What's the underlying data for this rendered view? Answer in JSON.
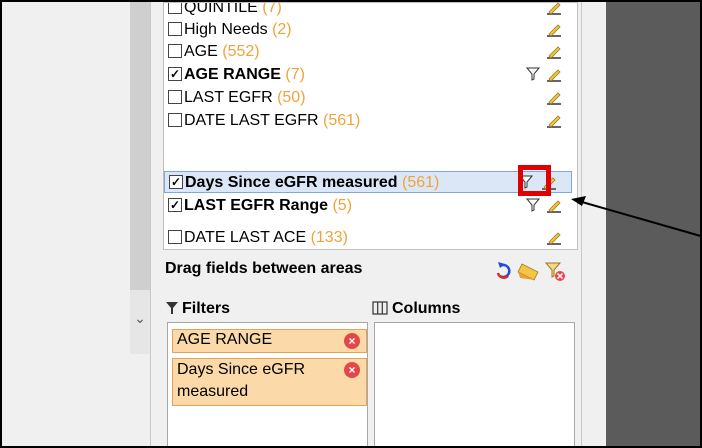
{
  "field_list": {
    "items": [
      {
        "label": "QUINTILE",
        "count": "(7)",
        "checked": false,
        "bold": false
      },
      {
        "label": "High Needs",
        "count": "(2)",
        "checked": false,
        "bold": false
      },
      {
        "label": "AGE",
        "count": "(552)",
        "checked": false,
        "bold": false
      },
      {
        "label": "AGE RANGE",
        "count": "(7)",
        "checked": true,
        "bold": true
      },
      {
        "label": "LAST EGFR",
        "count": "(50)",
        "checked": false,
        "bold": false
      },
      {
        "label": "DATE LAST EGFR",
        "count": "(561)",
        "checked": false,
        "bold": false
      },
      {
        "label": "Days Since eGFR measured",
        "count": "(561)",
        "checked": true,
        "bold": true
      },
      {
        "label": "LAST EGFR Range",
        "count": "(5)",
        "checked": true,
        "bold": true
      },
      {
        "label": "DATE LAST ACE",
        "count": "(133)",
        "checked": false,
        "bold": false
      }
    ],
    "check_mark": "✓"
  },
  "drag_area": {
    "title": "Drag fields between areas"
  },
  "filters": {
    "label": "Filters",
    "chips": [
      {
        "text": "AGE RANGE"
      },
      {
        "text": "Days Since eGFR measured"
      }
    ],
    "remove_glyph": "×"
  },
  "columns": {
    "label": "Columns"
  },
  "colors": {
    "count": "#f0a33a",
    "highlight": "#e00000",
    "chip_bg": "#fbd9a8",
    "dark_area": "#5b5b5b"
  },
  "icons": [
    "pencil-edit-icon",
    "filter-icon",
    "refresh-icon",
    "broom-icon",
    "clear-filter-icon",
    "chevron-down-icon",
    "columns-icon"
  ]
}
